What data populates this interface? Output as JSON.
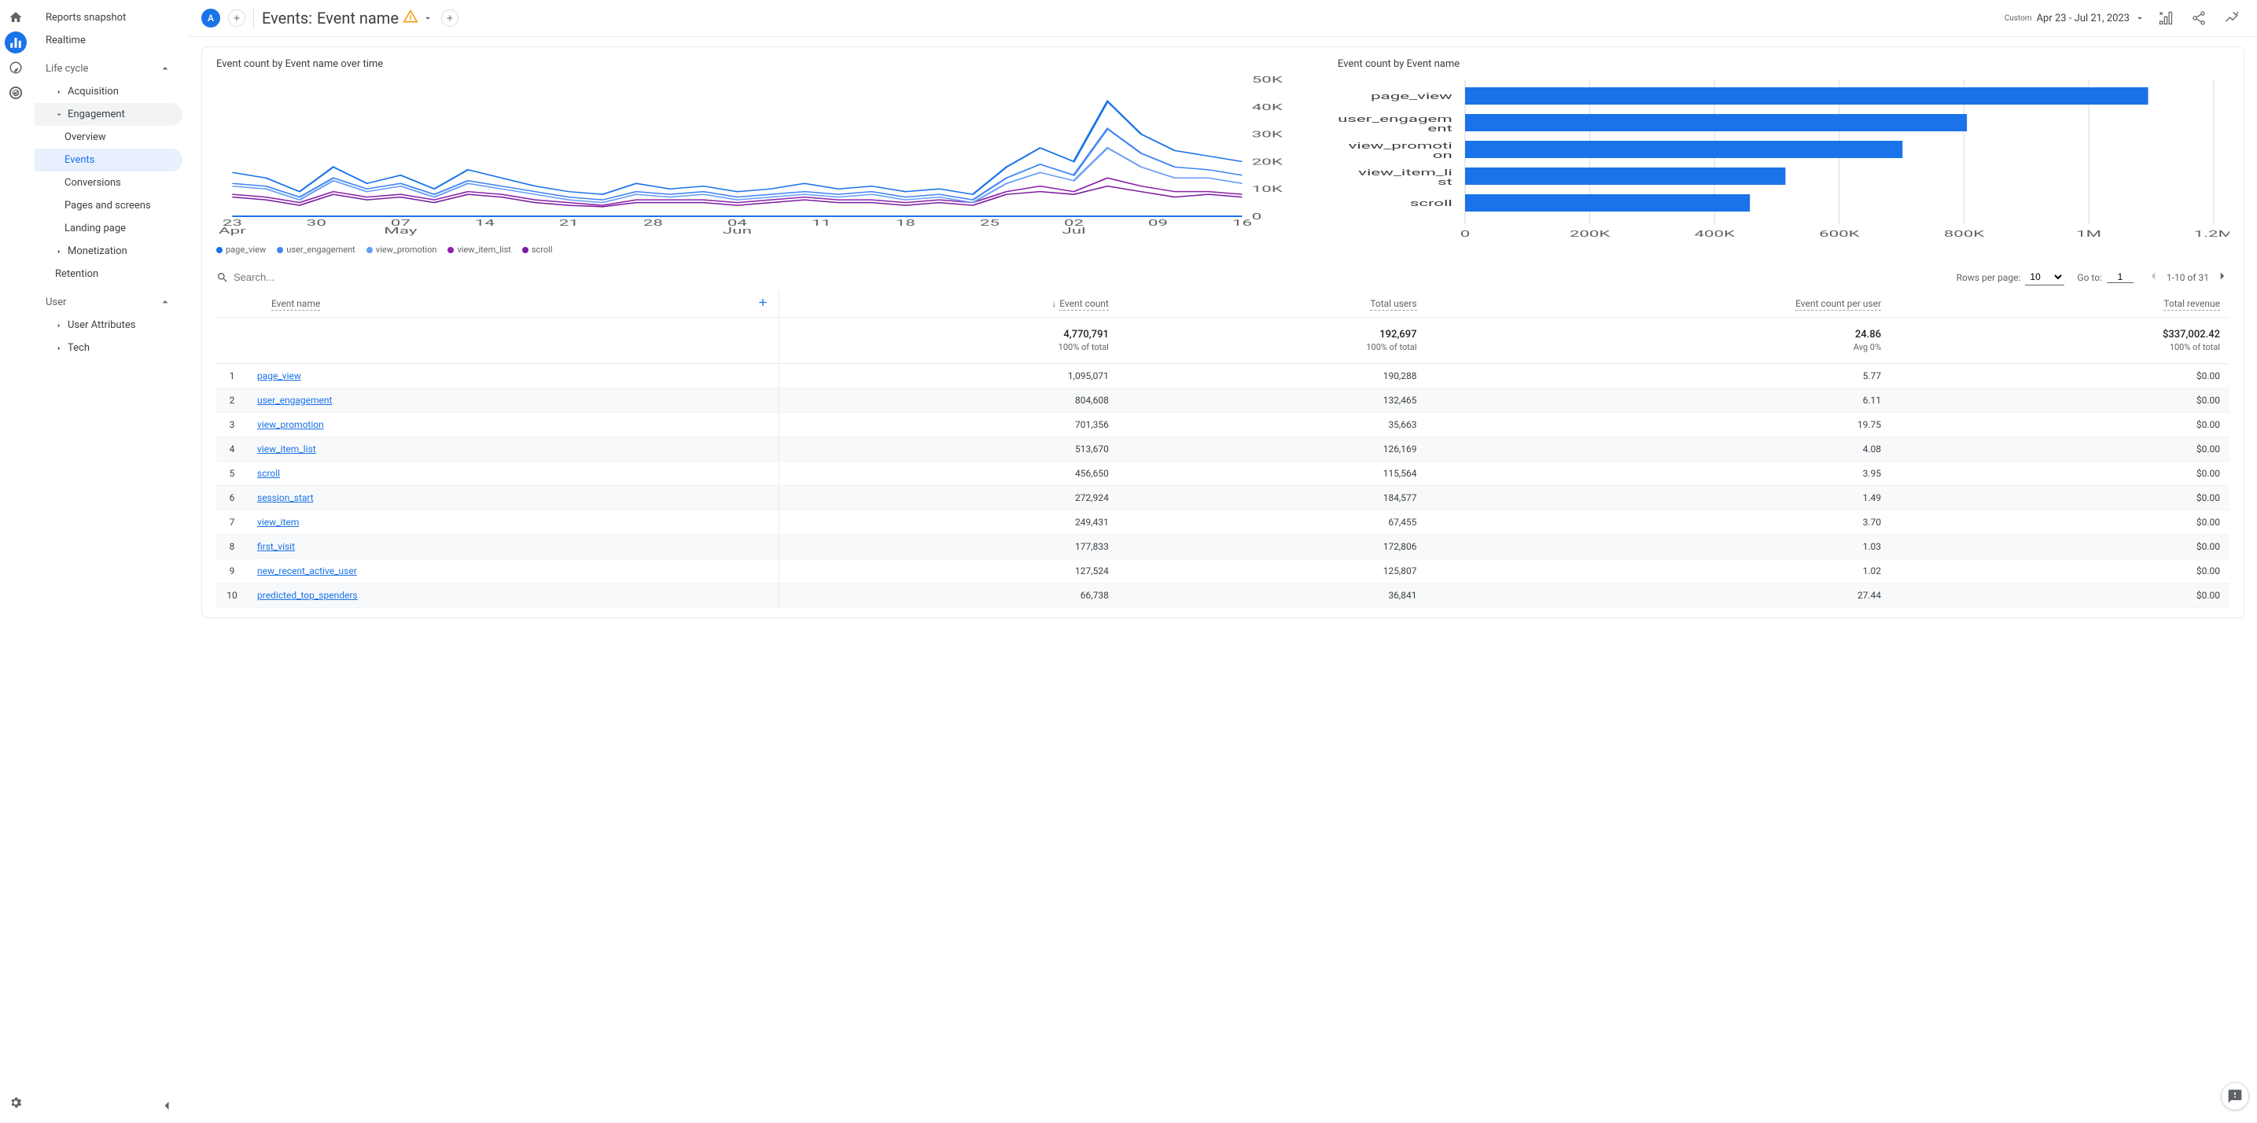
{
  "rail": {
    "items": [
      "home",
      "reports",
      "explore",
      "advertising"
    ],
    "active_index": 1
  },
  "sidebar": {
    "items": [
      {
        "label": "Reports snapshot",
        "type": "item"
      },
      {
        "label": "Realtime",
        "type": "item"
      },
      {
        "label": "Life cycle",
        "type": "section",
        "expanded": true
      },
      {
        "label": "Acquisition",
        "type": "expandable",
        "level": 1,
        "expanded": false
      },
      {
        "label": "Engagement",
        "type": "expandable",
        "level": 1,
        "expanded": true,
        "highlight": "open"
      },
      {
        "label": "Overview",
        "type": "item",
        "level": 2
      },
      {
        "label": "Events",
        "type": "item",
        "level": 2,
        "selected": true
      },
      {
        "label": "Conversions",
        "type": "item",
        "level": 2
      },
      {
        "label": "Pages and screens",
        "type": "item",
        "level": 2
      },
      {
        "label": "Landing page",
        "type": "item",
        "level": 2
      },
      {
        "label": "Monetization",
        "type": "expandable",
        "level": 1,
        "expanded": false
      },
      {
        "label": "Retention",
        "type": "item",
        "level": 1
      },
      {
        "label": "User",
        "type": "section",
        "expanded": true
      },
      {
        "label": "User Attributes",
        "type": "expandable",
        "level": 1,
        "expanded": false
      },
      {
        "label": "Tech",
        "type": "expandable",
        "level": 1,
        "expanded": false
      }
    ]
  },
  "header": {
    "segment_chip": "A",
    "title_prefix": "Events:",
    "title_dim": "Event name",
    "date_range_label": "Apr 23 - Jul 21, 2023",
    "date_range_custom": "Custom"
  },
  "chart_data": [
    {
      "type": "line",
      "title": "Event count by Event name over time",
      "ylabel": "",
      "xlabel": "",
      "ylim": [
        0,
        50000
      ],
      "y_ticks": [
        0,
        10000,
        20000,
        30000,
        40000,
        50000
      ],
      "y_tick_labels": [
        "0",
        "10K",
        "20K",
        "30K",
        "40K",
        "50K"
      ],
      "x_ticks": [
        "23\nApr",
        "30",
        "07\nMay",
        "14",
        "21",
        "28",
        "04\nJun",
        "11",
        "18",
        "25",
        "02\nJul",
        "09",
        "16"
      ],
      "x": [
        0,
        1,
        2,
        3,
        4,
        5,
        6,
        7,
        8,
        9,
        10,
        11,
        12,
        13,
        14,
        15,
        16,
        17,
        18,
        19,
        20,
        21,
        22,
        23,
        24,
        25,
        26,
        27,
        28,
        29,
        30
      ],
      "series": [
        {
          "name": "page_view",
          "color": "#1a73e8",
          "values": [
            16000,
            14000,
            9000,
            18000,
            12000,
            15000,
            10000,
            17000,
            14000,
            11000,
            9000,
            8000,
            12000,
            10000,
            11000,
            9000,
            10000,
            12000,
            10000,
            11000,
            9000,
            10000,
            8000,
            18000,
            25000,
            20000,
            42000,
            30000,
            24000,
            22000,
            20000
          ]
        },
        {
          "name": "user_engagement",
          "color": "#4285f4",
          "values": [
            12000,
            11000,
            7000,
            14000,
            10000,
            12000,
            8000,
            13000,
            11000,
            9000,
            7000,
            6000,
            9000,
            8000,
            9000,
            7000,
            8000,
            9000,
            8000,
            9000,
            7000,
            8000,
            6000,
            14000,
            19000,
            15000,
            32000,
            23000,
            18000,
            17000,
            15000
          ]
        },
        {
          "name": "view_promotion",
          "color": "#669df6",
          "values": [
            11000,
            10000,
            6000,
            13000,
            9000,
            11000,
            7000,
            12000,
            10000,
            8000,
            6000,
            5000,
            8000,
            7000,
            8000,
            6000,
            7000,
            8000,
            7000,
            8000,
            6000,
            7000,
            5000,
            12000,
            16000,
            13000,
            25000,
            18000,
            14000,
            14000,
            12000
          ]
        },
        {
          "name": "view_item_list",
          "color": "#8e24aa",
          "values": [
            8000,
            7000,
            5000,
            9000,
            7000,
            8000,
            6000,
            9000,
            8000,
            6000,
            5000,
            4000,
            6000,
            6000,
            6000,
            5000,
            6000,
            7000,
            6000,
            6000,
            5000,
            6000,
            5000,
            9000,
            11000,
            9000,
            14000,
            11000,
            9000,
            9000,
            8000
          ]
        },
        {
          "name": "scroll",
          "color": "#7b1fa2",
          "values": [
            7000,
            6000,
            4000,
            8000,
            6000,
            7000,
            5000,
            8000,
            7000,
            5000,
            4000,
            3500,
            5000,
            5000,
            5000,
            4000,
            5000,
            6000,
            5000,
            5000,
            4000,
            5000,
            4000,
            8000,
            9000,
            8000,
            11000,
            9000,
            7000,
            8000,
            7000
          ]
        }
      ]
    },
    {
      "type": "bar",
      "title": "Event count by Event name",
      "orientation": "horizontal",
      "xlim": [
        0,
        1200000
      ],
      "x_ticks": [
        0,
        200000,
        400000,
        600000,
        800000,
        1000000,
        1200000
      ],
      "x_tick_labels": [
        "0",
        "200K",
        "400K",
        "600K",
        "800K",
        "1M",
        "1.2M"
      ],
      "categories": [
        "page_view",
        "user_engagement",
        "view_promotion",
        "view_item_list",
        "scroll"
      ],
      "values": [
        1095071,
        804608,
        701356,
        513670,
        456650
      ],
      "color": "#1a73e8"
    }
  ],
  "table": {
    "search_placeholder": "Search...",
    "rows_per_page_label": "Rows per page:",
    "rows_per_page_value": "10",
    "goto_label": "Go to:",
    "goto_value": "1",
    "range_label": "1-10 of 31",
    "columns": [
      "Event name",
      "Event count",
      "Total users",
      "Event count per user",
      "Total revenue"
    ],
    "sort_column": "Event count",
    "sort_dir": "desc",
    "totals": {
      "event_count": {
        "value": "4,770,791",
        "sub": "100% of total"
      },
      "total_users": {
        "value": "192,697",
        "sub": "100% of total"
      },
      "per_user": {
        "value": "24.86",
        "sub": "Avg 0%"
      },
      "revenue": {
        "value": "$337,002.42",
        "sub": "100% of total"
      }
    },
    "rows": [
      {
        "idx": 1,
        "name": "page_view",
        "event_count": "1,095,071",
        "total_users": "190,288",
        "per_user": "5.77",
        "revenue": "$0.00"
      },
      {
        "idx": 2,
        "name": "user_engagement",
        "event_count": "804,608",
        "total_users": "132,465",
        "per_user": "6.11",
        "revenue": "$0.00"
      },
      {
        "idx": 3,
        "name": "view_promotion",
        "event_count": "701,356",
        "total_users": "35,663",
        "per_user": "19.75",
        "revenue": "$0.00"
      },
      {
        "idx": 4,
        "name": "view_item_list",
        "event_count": "513,670",
        "total_users": "126,169",
        "per_user": "4.08",
        "revenue": "$0.00"
      },
      {
        "idx": 5,
        "name": "scroll",
        "event_count": "456,650",
        "total_users": "115,564",
        "per_user": "3.95",
        "revenue": "$0.00"
      },
      {
        "idx": 6,
        "name": "session_start",
        "event_count": "272,924",
        "total_users": "184,577",
        "per_user": "1.49",
        "revenue": "$0.00"
      },
      {
        "idx": 7,
        "name": "view_item",
        "event_count": "249,431",
        "total_users": "67,455",
        "per_user": "3.70",
        "revenue": "$0.00"
      },
      {
        "idx": 8,
        "name": "first_visit",
        "event_count": "177,833",
        "total_users": "172,806",
        "per_user": "1.03",
        "revenue": "$0.00"
      },
      {
        "idx": 9,
        "name": "new_recent_active_user",
        "event_count": "127,524",
        "total_users": "125,807",
        "per_user": "1.02",
        "revenue": "$0.00"
      },
      {
        "idx": 10,
        "name": "predicted_top_spenders",
        "event_count": "66,738",
        "total_users": "36,841",
        "per_user": "27.44",
        "revenue": "$0.00"
      }
    ]
  }
}
